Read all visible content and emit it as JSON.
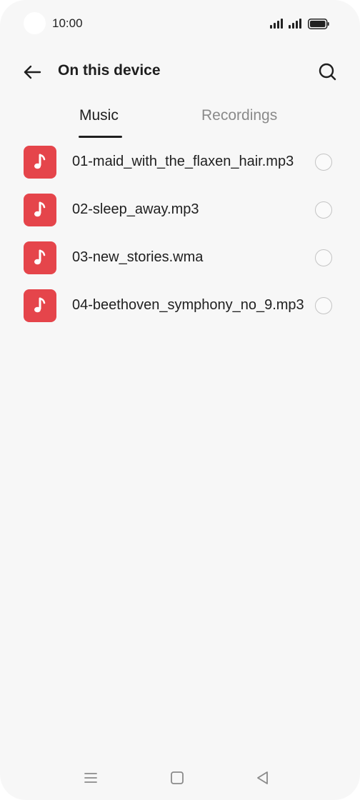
{
  "status_bar": {
    "time": "10:00",
    "icons": [
      "signal-icon",
      "signal-icon",
      "battery-icon"
    ]
  },
  "header": {
    "title": "On this device",
    "back_icon": "arrow-left-icon",
    "search_icon": "search-icon"
  },
  "tabs": [
    {
      "label": "Music",
      "active": true
    },
    {
      "label": "Recordings",
      "active": false
    }
  ],
  "files": [
    {
      "name": "01-maid_with_the_flaxen_hair.mp3",
      "icon": "music-note-icon",
      "selected": false
    },
    {
      "name": "02-sleep_away.mp3",
      "icon": "music-note-icon",
      "selected": false
    },
    {
      "name": "03-new_stories.wma",
      "icon": "music-note-icon",
      "selected": false
    },
    {
      "name": "04-beethoven_symphony_no_9.mp3",
      "icon": "music-note-icon",
      "selected": false
    }
  ],
  "nav_bar": {
    "icons": [
      "menu-icon",
      "home-icon",
      "back-triangle-icon"
    ]
  },
  "colors": {
    "background": "#f7f7f7",
    "accent": "#e5454b",
    "text_primary": "#1f1f1f",
    "text_secondary": "#8a8a8a"
  }
}
